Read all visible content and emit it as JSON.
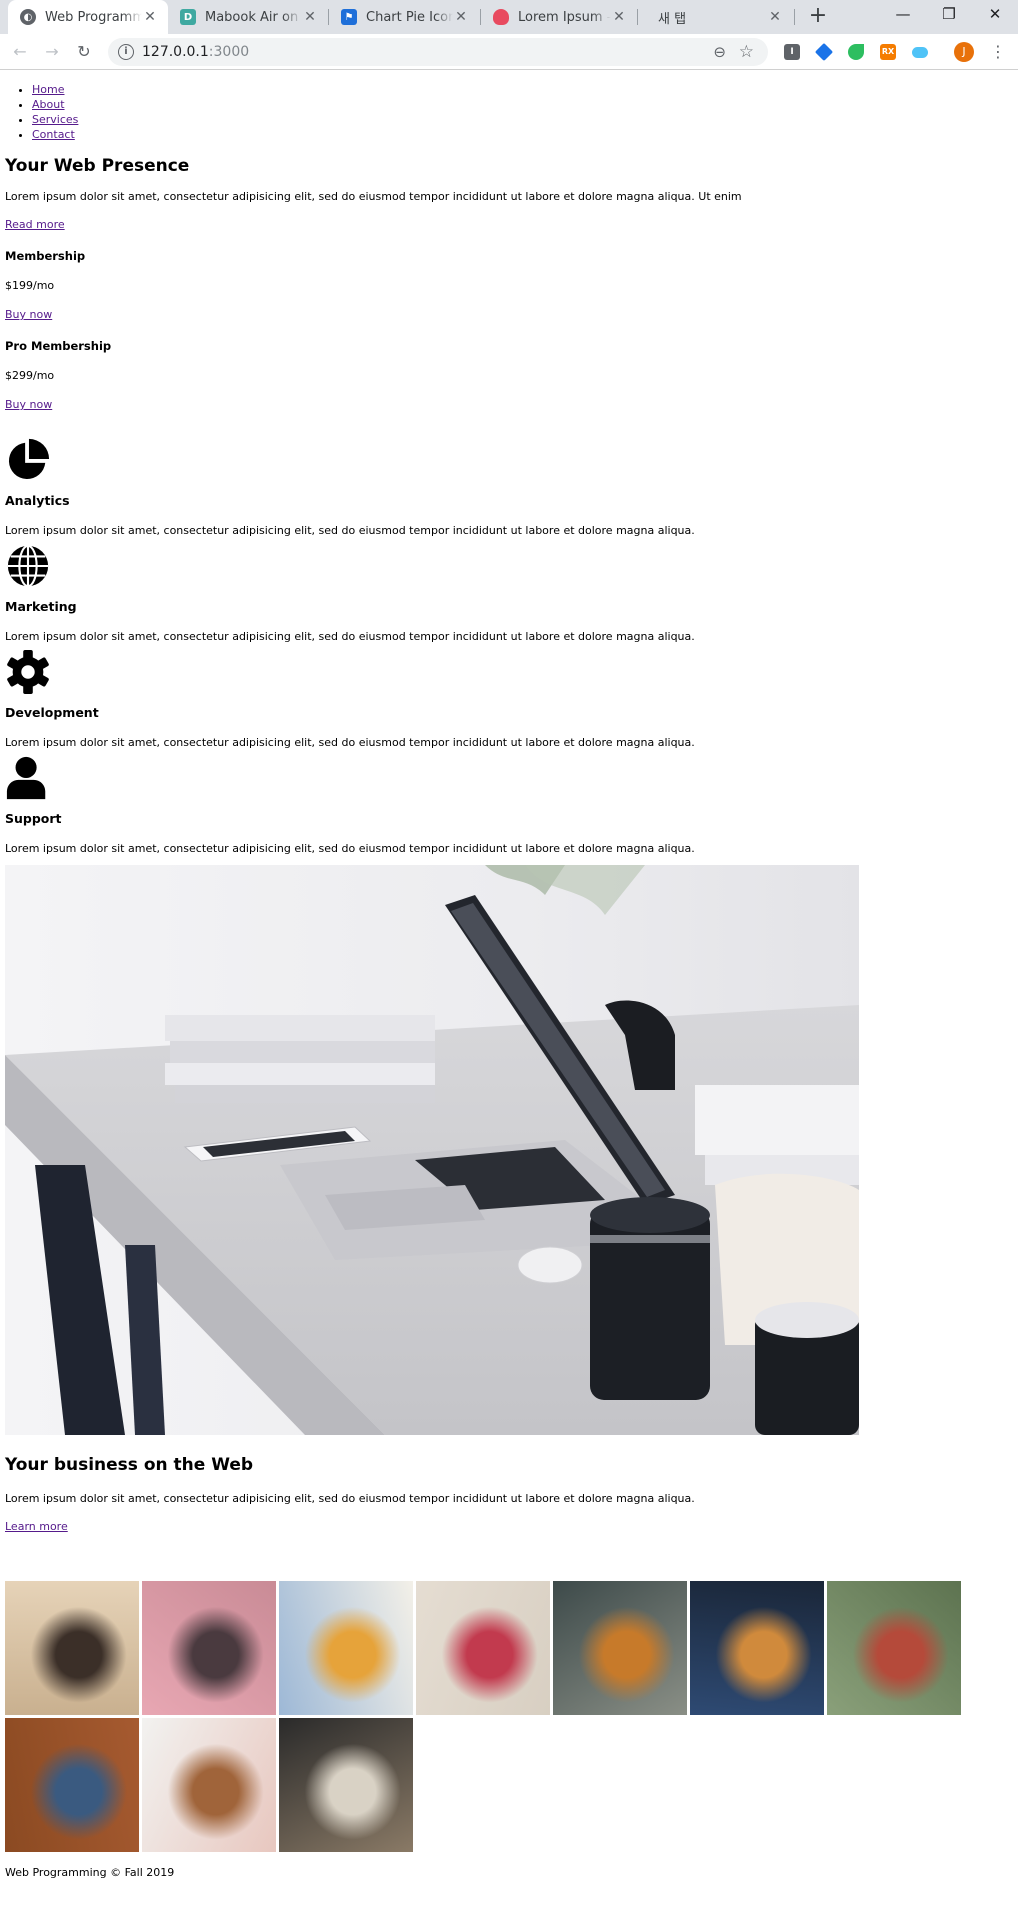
{
  "browser": {
    "tabs": [
      {
        "title": "Web Programming",
        "favicon_color": "#5f6368",
        "active": true
      },
      {
        "title": "Mabook Air on",
        "favicon_color": "#3fa9a1",
        "favicon_letter": "D",
        "active": false
      },
      {
        "title": "Chart Pie Icon |",
        "favicon_color": "#1e6fd9",
        "active": false
      },
      {
        "title": "Lorem Ipsum – G",
        "favicon_color": "#e84a5f",
        "active": false
      },
      {
        "title": "새 탭",
        "favicon_color": "",
        "active": false
      }
    ],
    "new_tab_label": "+",
    "url_host": "127.0.0.1",
    "url_port": ":3000",
    "profile_letter": "J",
    "extensions": [
      {
        "name": "instapaper-icon",
        "color": "#5f6368",
        "label": "I"
      },
      {
        "name": "graduation-icon",
        "color": "#1a73e8",
        "label": ""
      },
      {
        "name": "evernote-icon",
        "color": "#2dbe60",
        "label": ""
      },
      {
        "name": "rss-icon",
        "color": "#f57c00",
        "label": "RX"
      },
      {
        "name": "cloud-icon",
        "color": "#4fc3f7",
        "label": ""
      }
    ]
  },
  "nav": {
    "items": [
      "Home",
      "About",
      "Services",
      "Contact"
    ]
  },
  "hero": {
    "title": "Your Web Presence",
    "text": "Lorem ipsum dolor sit amet, consectetur adipisicing elit, sed do eiusmod tempor incididunt ut labore et dolore magna aliqua. Ut enim",
    "link": "Read more"
  },
  "plans": [
    {
      "name": "Membership",
      "price": "$199/mo",
      "cta": "Buy now"
    },
    {
      "name": "Pro Membership",
      "price": "$299/mo",
      "cta": "Buy now"
    }
  ],
  "features": [
    {
      "icon": "chart-pie-icon",
      "title": "Analytics",
      "text": "Lorem ipsum dolor sit amet, consectetur adipisicing elit, sed do eiusmod tempor incididunt ut labore et dolore magna aliqua."
    },
    {
      "icon": "globe-icon",
      "title": "Marketing",
      "text": "Lorem ipsum dolor sit amet, consectetur adipisicing elit, sed do eiusmod tempor incididunt ut labore et dolore magna aliqua."
    },
    {
      "icon": "gear-icon",
      "title": "Development",
      "text": "Lorem ipsum dolor sit amet, consectetur adipisicing elit, sed do eiusmod tempor incididunt ut labore et dolore magna aliqua."
    },
    {
      "icon": "user-icon",
      "title": "Support",
      "text": "Lorem ipsum dolor sit amet, consectetur adipisicing elit, sed do eiusmod tempor incididunt ut labore et dolore magna aliqua."
    }
  ],
  "business": {
    "title": "Your business on the Web",
    "text": "Lorem ipsum dolor sit amet, consectetur adipisicing elit, sed do eiusmod tempor incididunt ut labore et dolore magna aliqua.",
    "link": "Learn more"
  },
  "gallery": [
    {
      "name": "woman-portrait",
      "colors": [
        "#c9b08f",
        "#3b2f28",
        "#e6d3b8"
      ]
    },
    {
      "name": "pink-building",
      "colors": [
        "#e8a7b3",
        "#4a3a3f",
        "#c98b96"
      ]
    },
    {
      "name": "picnic-food",
      "colors": [
        "#9db8d6",
        "#e6a33a",
        "#f3f0e8"
      ]
    },
    {
      "name": "ribbon-tape",
      "colors": [
        "#e5ddd2",
        "#c23a4e",
        "#d8cfc2"
      ]
    },
    {
      "name": "autumn-leaf",
      "colors": [
        "#3d4a4a",
        "#c77a2a",
        "#8a8f86"
      ]
    },
    {
      "name": "city-bridge",
      "colors": [
        "#2e4a73",
        "#d08a3c",
        "#1a2638"
      ]
    },
    {
      "name": "berry-bush",
      "colors": [
        "#8aa07a",
        "#b54a3a",
        "#5d7350"
      ]
    },
    {
      "name": "hiking-boots",
      "colors": [
        "#8b4a22",
        "#3a5a80",
        "#a65a30"
      ]
    },
    {
      "name": "bathroom-vanity",
      "colors": [
        "#f2f2f0",
        "#a0643a",
        "#e8c7bf"
      ]
    },
    {
      "name": "chalkboard-cafe",
      "colors": [
        "#2a2a2a",
        "#d9d2c5",
        "#8a7a66"
      ]
    }
  ],
  "footer": {
    "text": "Web Programming © Fall 2019"
  }
}
